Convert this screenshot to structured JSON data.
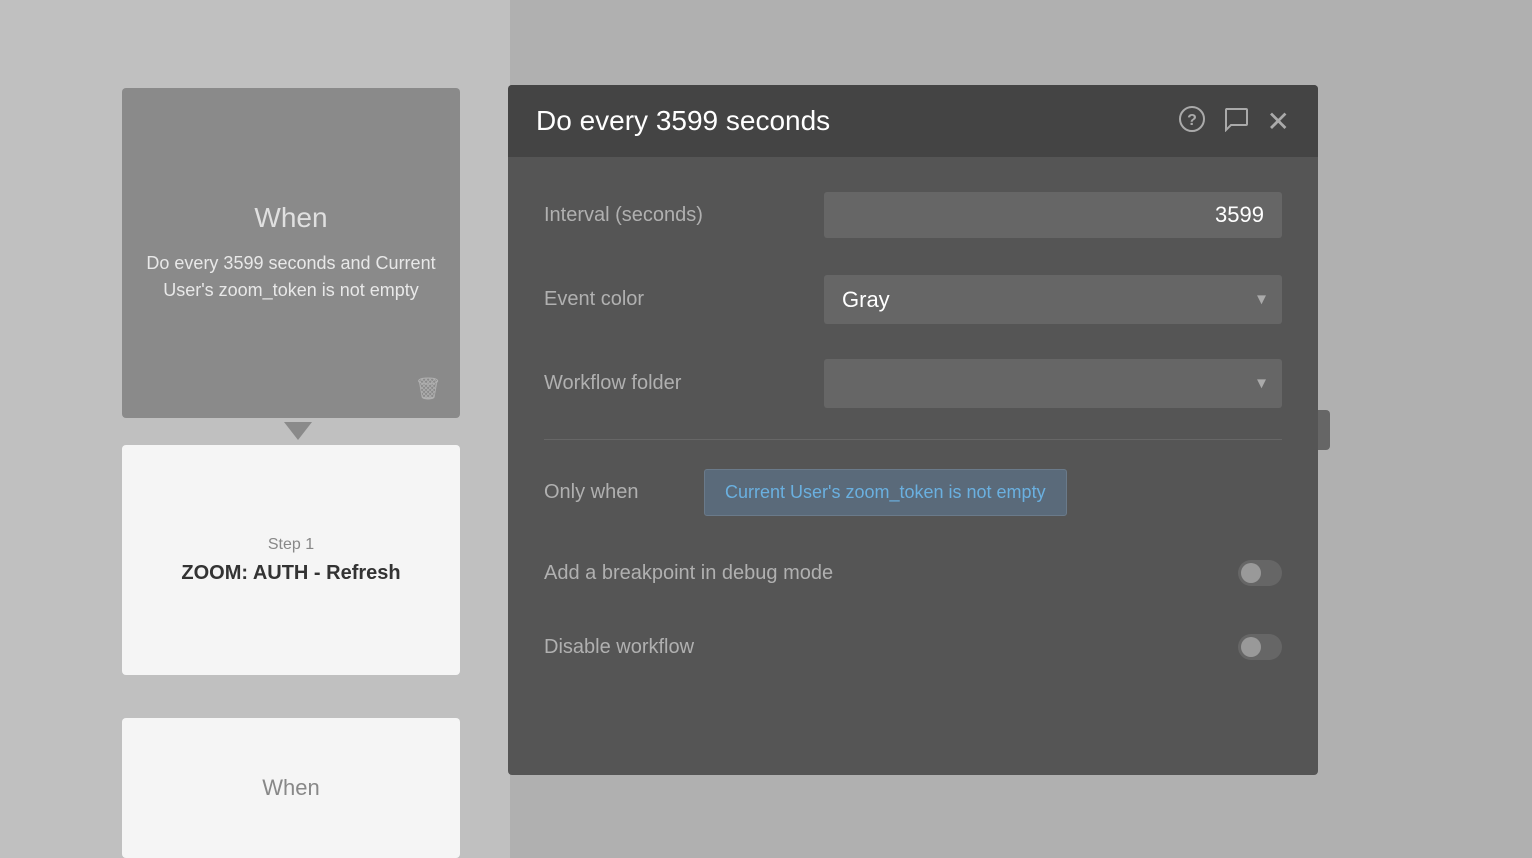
{
  "leftPanel": {
    "whenCardTop": {
      "title": "When",
      "description": "Do every 3599 seconds and Current User's zoom_token is not empty",
      "trashIcon": "🗑"
    },
    "stepCard": {
      "stepLabel": "Step 1",
      "stepName": "ZOOM: AUTH - Refresh"
    },
    "whenCardBottom": {
      "title": "When"
    }
  },
  "modal": {
    "title": "Do every 3599 seconds",
    "helpIcon": "?",
    "commentIcon": "💬",
    "closeIcon": "✕",
    "fields": {
      "intervalLabel": "Interval (seconds)",
      "intervalValue": "3599",
      "eventColorLabel": "Event color",
      "eventColorValue": "Gray",
      "workflowFolderLabel": "Workflow folder",
      "workflowFolderValue": "",
      "onlyWhenLabel": "Only when",
      "conditionText": "Current User's zoom_token is not empty",
      "breakpointLabel": "Add a breakpoint in debug mode",
      "disableLabel": "Disable workflow"
    },
    "chevronDown": "▾",
    "colors": {
      "accent": "#6ab0e0",
      "panelBg": "#555555",
      "headerBg": "#444444",
      "inputBg": "#666666",
      "conditionBg": "#5a6a7a"
    }
  }
}
